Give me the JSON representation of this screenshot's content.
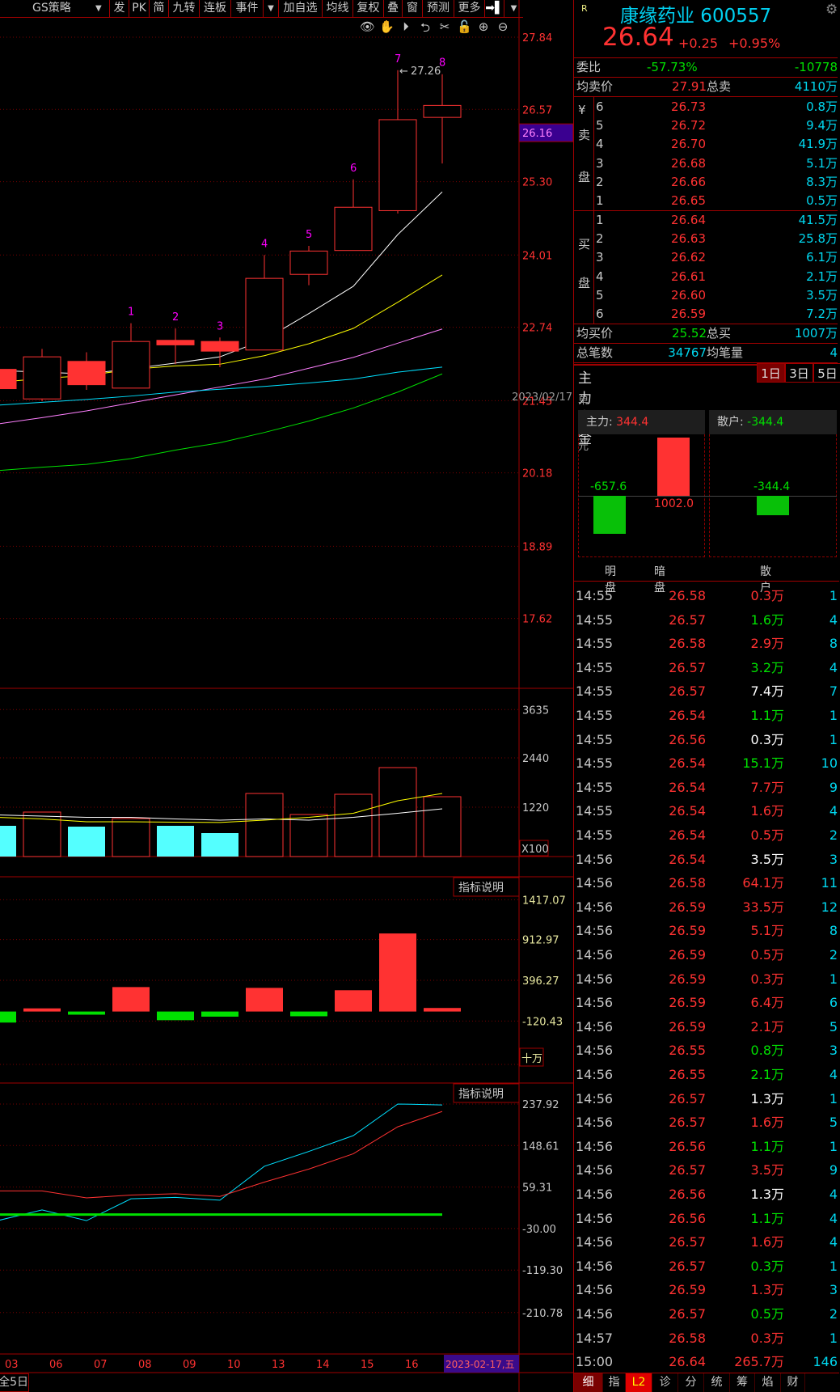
{
  "toolbar": {
    "strategy": "GS策略",
    "dropdown": "▼",
    "items": [
      "发",
      "PK",
      "简",
      "九转",
      "连板",
      "事件",
      "▼",
      "加自选",
      "均线",
      "复权",
      "叠",
      "窗",
      "预测",
      "更多",
      "➡▌",
      "▼"
    ],
    "icons": [
      "eye-icon",
      "hand-icon",
      "play-icon",
      "undo-icon",
      "scissors-icon",
      "lock-icon",
      "zoom-in-icon",
      "zoom-out-icon"
    ]
  },
  "quote": {
    "badge": "R",
    "name": "康缘药业 600557",
    "price": "26.64",
    "change": "+0.25",
    "change_pct": "+0.95%",
    "weibi_label": "委比",
    "weibi_pct": "-57.73%",
    "weibi_val": "-10778",
    "avg_sell_label": "均卖价",
    "avg_sell": "27.91",
    "total_sell_label": "总卖",
    "total_sell": "4110万",
    "sell_side": [
      "¥",
      "卖",
      "盘"
    ],
    "buy_side": [
      "买",
      "盘"
    ],
    "sells": [
      [
        "6",
        "26.73",
        "0.8万"
      ],
      [
        "5",
        "26.72",
        "9.4万"
      ],
      [
        "4",
        "26.70",
        "41.9万"
      ],
      [
        "3",
        "26.68",
        "5.1万"
      ],
      [
        "2",
        "26.66",
        "8.3万"
      ],
      [
        "1",
        "26.65",
        "0.5万"
      ]
    ],
    "buys": [
      [
        "1",
        "26.64",
        "41.5万"
      ],
      [
        "2",
        "26.63",
        "25.8万"
      ],
      [
        "3",
        "26.62",
        "6.1万"
      ],
      [
        "4",
        "26.61",
        "2.1万"
      ],
      [
        "5",
        "26.60",
        "3.5万"
      ],
      [
        "6",
        "26.59",
        "7.2万"
      ]
    ],
    "avg_buy_label": "均买价",
    "avg_buy": "25.52",
    "total_buy_label": "总买",
    "total_buy": "1007万",
    "trades_label": "总笔数",
    "trades": "34767",
    "avg_vol_label": "均笔量",
    "avg_vol": "4"
  },
  "fund": {
    "title": "主力资金",
    "periods": [
      "1日",
      "3日",
      "5日"
    ],
    "active_period": "1日",
    "unit": "单位:万元",
    "date": "2023/02/17",
    "main_label": "主力:",
    "main_value": "344.4",
    "retail_label": "散户:",
    "retail_value": "-344.4",
    "bars": [
      {
        "label": "明盘",
        "value": "-657.6"
      },
      {
        "label": "暗盘",
        "value": "1002.0"
      },
      {
        "label": "散户",
        "value": "-344.4"
      }
    ]
  },
  "ticks": [
    [
      "14:55",
      "26.58",
      "0.3万",
      "r",
      "1"
    ],
    [
      "14:55",
      "26.57",
      "1.6万",
      "g",
      "4"
    ],
    [
      "14:55",
      "26.58",
      "2.9万",
      "r",
      "8"
    ],
    [
      "14:55",
      "26.57",
      "3.2万",
      "g",
      "4"
    ],
    [
      "14:55",
      "26.57",
      "7.4万",
      "w",
      "7"
    ],
    [
      "14:55",
      "26.54",
      "1.1万",
      "g",
      "1"
    ],
    [
      "14:55",
      "26.56",
      "0.3万",
      "w",
      "1"
    ],
    [
      "14:55",
      "26.54",
      "15.1万",
      "g",
      "10"
    ],
    [
      "14:55",
      "26.54",
      "7.7万",
      "r",
      "9"
    ],
    [
      "14:55",
      "26.54",
      "1.6万",
      "r",
      "4"
    ],
    [
      "14:55",
      "26.54",
      "0.5万",
      "r",
      "2"
    ],
    [
      "14:56",
      "26.54",
      "3.5万",
      "w",
      "3"
    ],
    [
      "14:56",
      "26.58",
      "64.1万",
      "r",
      "11"
    ],
    [
      "14:56",
      "26.59",
      "33.5万",
      "r",
      "12"
    ],
    [
      "14:56",
      "26.59",
      "5.1万",
      "r",
      "8"
    ],
    [
      "14:56",
      "26.59",
      "0.5万",
      "r",
      "2"
    ],
    [
      "14:56",
      "26.59",
      "0.3万",
      "r",
      "1"
    ],
    [
      "14:56",
      "26.59",
      "6.4万",
      "r",
      "6"
    ],
    [
      "14:56",
      "26.59",
      "2.1万",
      "r",
      "5"
    ],
    [
      "14:56",
      "26.55",
      "0.8万",
      "g",
      "3"
    ],
    [
      "14:56",
      "26.55",
      "2.1万",
      "g",
      "4"
    ],
    [
      "14:56",
      "26.57",
      "1.3万",
      "w",
      "1"
    ],
    [
      "14:56",
      "26.57",
      "1.6万",
      "r",
      "5"
    ],
    [
      "14:56",
      "26.56",
      "1.1万",
      "g",
      "1"
    ],
    [
      "14:56",
      "26.57",
      "3.5万",
      "r",
      "9"
    ],
    [
      "14:56",
      "26.56",
      "1.3万",
      "w",
      "4"
    ],
    [
      "14:56",
      "26.56",
      "1.1万",
      "g",
      "4"
    ],
    [
      "14:56",
      "26.57",
      "1.6万",
      "r",
      "4"
    ],
    [
      "14:56",
      "26.57",
      "0.3万",
      "g",
      "1"
    ],
    [
      "14:56",
      "26.59",
      "1.3万",
      "r",
      "3"
    ],
    [
      "14:56",
      "26.57",
      "0.5万",
      "g",
      "2"
    ],
    [
      "14:57",
      "26.58",
      "0.3万",
      "r",
      "1"
    ],
    [
      "15:00",
      "26.64",
      "265.7万",
      "r",
      "146"
    ]
  ],
  "bottom_tabs": [
    "细",
    "指",
    "L2",
    "诊",
    "分",
    "统",
    "筹",
    "焰",
    "财"
  ],
  "active_tab": "L2",
  "period_tab": "全5日",
  "colors": {
    "up": "#ff3232",
    "down": "#00e000",
    "vol_down": "#54ffff",
    "border": "#a00000",
    "marker": "#ff00ff"
  },
  "chart_data": {
    "type": "candlestick",
    "dates": [
      "03",
      "06",
      "07",
      "08",
      "09",
      "10",
      "13",
      "14",
      "15",
      "16",
      "2023-02-17,五"
    ],
    "ohlc": [
      [
        22.0,
        22.05,
        21.6,
        21.66
      ],
      [
        21.48,
        22.36,
        21.44,
        22.22
      ],
      [
        22.14,
        22.3,
        21.64,
        21.73
      ],
      [
        21.67,
        22.81,
        21.67,
        22.49
      ],
      [
        22.51,
        22.72,
        22.09,
        22.43
      ],
      [
        22.49,
        22.56,
        22.04,
        22.32
      ],
      [
        22.34,
        24.01,
        22.34,
        23.6
      ],
      [
        23.67,
        24.17,
        23.48,
        24.08
      ],
      [
        24.09,
        25.34,
        24.09,
        24.85
      ],
      [
        24.79,
        27.26,
        24.74,
        26.39
      ],
      [
        26.43,
        27.19,
        25.62,
        26.64
      ]
    ],
    "markers": [
      "",
      "",
      "",
      "1",
      "2",
      "3",
      "4",
      "5",
      "6",
      "7",
      "8"
    ],
    "high_annotation": "27.26",
    "price_ticks": [
      "27.84",
      "26.57",
      "25.30",
      "24.01",
      "22.74",
      "21.45",
      "20.18",
      "18.89",
      "17.62"
    ],
    "crosshair_price": "26.16",
    "ma_lines": [
      {
        "color": "#ffffff",
        "values": [
          21.98,
          21.95,
          21.92,
          22.01,
          22.11,
          22.22,
          22.52,
          22.98,
          23.46,
          24.37,
          25.12
        ]
      },
      {
        "color": "#ffff00",
        "values": [
          21.77,
          21.84,
          21.89,
          22.0,
          22.06,
          22.09,
          22.24,
          22.45,
          22.72,
          23.18,
          23.66
        ]
      },
      {
        "color": "#ff80ff",
        "values": [
          21.04,
          21.15,
          21.27,
          21.41,
          21.55,
          21.69,
          21.83,
          22.02,
          22.21,
          22.46,
          22.71
        ]
      },
      {
        "color": "#00e0ff",
        "values": [
          21.37,
          21.42,
          21.47,
          21.53,
          21.6,
          21.65,
          21.7,
          21.76,
          21.83,
          21.95,
          22.04
        ]
      },
      {
        "color": "#00e000",
        "values": [
          20.22,
          20.28,
          20.33,
          20.43,
          20.58,
          20.71,
          20.89,
          21.09,
          21.32,
          21.6,
          21.92
        ]
      }
    ],
    "volume": {
      "values": [
        760,
        1100,
        740,
        940,
        760,
        580,
        1560,
        1040,
        1540,
        2200,
        1480
      ],
      "ticks": [
        "3635",
        "2440",
        "1220"
      ],
      "unit": "X100",
      "ma": [
        {
          "color": "#ffffff",
          "values": [
            1030,
            1000,
            970,
            970,
            930,
            900,
            930,
            900,
            970,
            1070,
            1180
          ]
        },
        {
          "color": "#ffff00",
          "values": [
            970,
            930,
            860,
            860,
            850,
            843,
            900,
            970,
            1070,
            1380,
            1560
          ]
        }
      ]
    },
    "flow": {
      "values": [
        -140,
        40,
        -40,
        310,
        -110,
        -65,
        300,
        -60,
        270,
        990,
        45
      ],
      "ticks": [
        "1417.07",
        "912.97",
        "396.27",
        "-120.43"
      ],
      "unit": "十万",
      "legend_btn": "指标说明"
    },
    "indicator": {
      "ticks": [
        "237.92",
        "148.61",
        "59.31",
        "-30.00",
        "-119.30",
        "-210.78"
      ],
      "legend_btn": "指标说明",
      "lines": [
        {
          "color": "#00e0ff",
          "values": [
            -13,
            10,
            -13,
            34,
            37,
            31,
            104,
            136,
            170,
            238,
            236
          ]
        },
        {
          "color": "#ff3232",
          "values": [
            51,
            51,
            36,
            42,
            45,
            39,
            70,
            98,
            131,
            189,
            222
          ]
        },
        {
          "color": "#00e000",
          "values": [
            0,
            0,
            0,
            0,
            0,
            0,
            0,
            0,
            0,
            0,
            0
          ]
        }
      ]
    }
  }
}
